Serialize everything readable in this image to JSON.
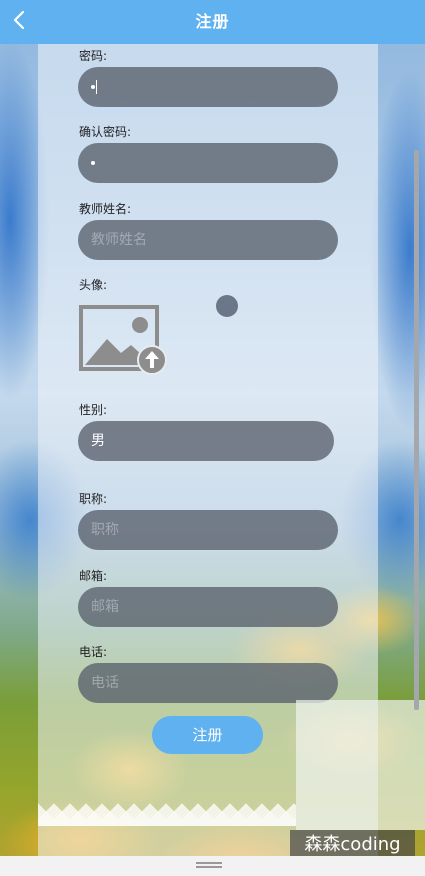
{
  "header": {
    "title": "注册",
    "back_icon": "chevron-left-icon"
  },
  "form": {
    "password": {
      "label": "密码:",
      "value_masked": true
    },
    "confirm_password": {
      "label": "确认密码:",
      "value_masked": true
    },
    "teacher_name": {
      "label": "教师姓名:",
      "placeholder": "教师姓名"
    },
    "avatar": {
      "label": "头像:",
      "icon": "image-upload-icon"
    },
    "gender": {
      "label": "性别:",
      "value": "男"
    },
    "title": {
      "label": "职称:",
      "placeholder": "职称"
    },
    "email": {
      "label": "邮箱:",
      "placeholder": "邮箱"
    },
    "phone": {
      "label": "电话:",
      "placeholder": "电话"
    },
    "submit_label": "注册"
  },
  "watermark": {
    "text": "森森coding"
  },
  "colors": {
    "header_bg": "#5fb1ef",
    "button_bg": "#5fb1ef",
    "field_bg": "#58606c"
  }
}
